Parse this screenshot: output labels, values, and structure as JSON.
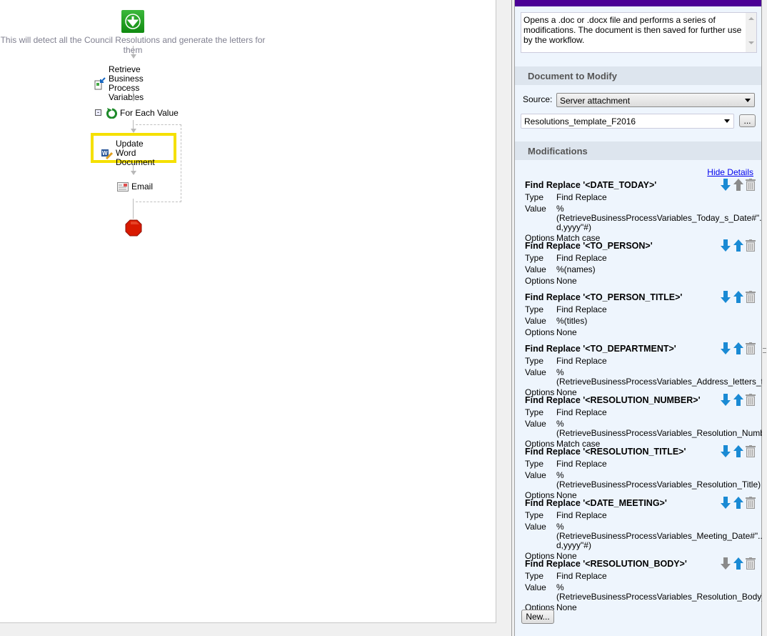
{
  "workflow": {
    "caption": "This will detect all the Council Resolutions and generate the letters for them",
    "steps": {
      "retrieve": "Retrieve Business Process Variables",
      "foreach": "For Each Value",
      "update": "Update Word Document",
      "email": "Email"
    }
  },
  "panel": {
    "description": "Opens a .doc or .docx file and performs a series of modifications. The document is then saved for further use by the workflow.",
    "doc_section": "Document to Modify",
    "source_label": "Source:",
    "source_value": "Server attachment",
    "file_value": "Resolutions_template_F2016",
    "browse_label": "...",
    "mods_section": "Modifications",
    "hide_details": "Hide Details",
    "labels": {
      "type": "Type",
      "value": "Value",
      "options": "Options"
    },
    "new_label": "New...",
    "modifications": [
      {
        "title": "Find Replace '<DATE_TODAY>'",
        "type": "Find Replace",
        "value": "%(RetrieveBusinessProcessVariables_Today_s_Date#\"... d,yyyy\"#)",
        "options": "Match case",
        "up": false,
        "down": true
      },
      {
        "title": "Find Replace '<TO_PERSON>'",
        "type": "Find Replace",
        "value": "%(names)",
        "options": "None",
        "up": true,
        "down": true
      },
      {
        "title": "Find Replace '<TO_PERSON_TITLE>'",
        "type": "Find Replace",
        "value": "%(titles)",
        "options": "None",
        "up": true,
        "down": true
      },
      {
        "title": "Find Replace '<TO_DEPARTMENT>'",
        "type": "Find Replace",
        "value": "%(RetrieveBusinessProcessVariables_Address_letters_t...",
        "options": "None",
        "up": true,
        "down": true
      },
      {
        "title": "Find Replace '<RESOLUTION_NUMBER>'",
        "type": "Find Replace",
        "value": "%(RetrieveBusinessProcessVariables_Resolution_Numb...",
        "options": "Match case",
        "up": true,
        "down": true
      },
      {
        "title": "Find Replace '<RESOLUTION_TITLE>'",
        "type": "Find Replace",
        "value": "%(RetrieveBusinessProcessVariables_Resolution_Title)",
        "options": "None",
        "up": true,
        "down": true
      },
      {
        "title": "Find Replace '<DATE_MEETING>'",
        "type": "Find Replace",
        "value": "%(RetrieveBusinessProcessVariables_Meeting_Date#\"... d,yyyy\"#)",
        "options": "None",
        "up": true,
        "down": true
      },
      {
        "title": "Find Replace '<RESOLUTION_BODY>'",
        "type": "Find Replace",
        "value": "%(RetrieveBusinessProcessVariables_Resolution_Body)",
        "options": "None",
        "up": true,
        "down": false
      }
    ],
    "colors": {
      "accent": "#4b0096",
      "arrow_active": "#1a8ad4",
      "arrow_disabled": "#8a8a8a",
      "highlight": "#f5e000"
    }
  }
}
